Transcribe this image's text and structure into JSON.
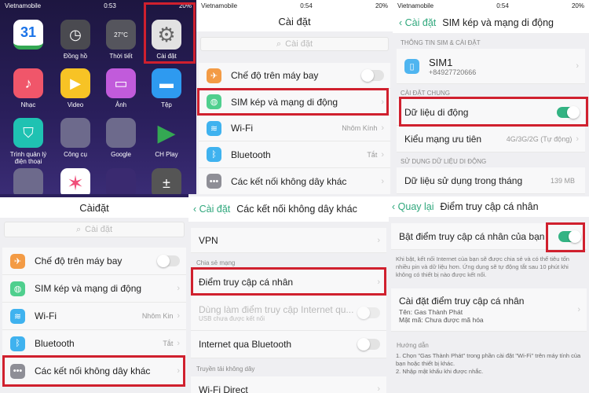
{
  "status": {
    "carrier": "Vietnamobile",
    "time1": "0:53",
    "time2": "0:54",
    "battery": "20%"
  },
  "home": {
    "apps": [
      {
        "label": "",
        "icon": "calendar-icon",
        "glyph": "31",
        "color": "#ffffff"
      },
      {
        "label": "Đồng hồ",
        "icon": "clock-icon",
        "glyph": "◷",
        "color": "#4a4a50"
      },
      {
        "label": "Thời tiết",
        "icon": "weather-icon",
        "glyph": "27°C",
        "color": "#55555d"
      },
      {
        "label": "Cài đặt",
        "icon": "gear-icon",
        "glyph": "⚙",
        "color": "#e2e2e2"
      },
      {
        "label": "Nhạc",
        "icon": "music-icon",
        "glyph": "♪",
        "color": "#f0566a"
      },
      {
        "label": "Video",
        "icon": "video-icon",
        "glyph": "▶",
        "color": "#f7c325"
      },
      {
        "label": "Ảnh",
        "icon": "photo-icon",
        "glyph": "▭",
        "color": "#c15bdb"
      },
      {
        "label": "Tệp",
        "icon": "folder-icon",
        "glyph": "▬",
        "color": "#2e9af0"
      },
      {
        "label": "Trình quản lý điện thoại",
        "icon": "shield-icon",
        "glyph": "⛉",
        "color": "#1fc2b2"
      },
      {
        "label": "Công cụ",
        "icon": "folder-tools-icon",
        "glyph": "",
        "color": "#6d6a8c"
      },
      {
        "label": "Google",
        "icon": "folder-google-icon",
        "glyph": "",
        "color": "#6d6a8c"
      },
      {
        "label": "CH Play",
        "icon": "play-store-icon",
        "glyph": "▶",
        "color": "transparent"
      },
      {
        "label": "",
        "icon": "folder-icon",
        "glyph": "",
        "color": "#6d6a8c"
      },
      {
        "label": "",
        "icon": "star-app-icon",
        "glyph": "✶",
        "color": "#ffffff"
      },
      {
        "label": "",
        "icon": "game-icon",
        "glyph": "",
        "color": "#3a2a70"
      },
      {
        "label": "",
        "icon": "calculator-icon",
        "glyph": "±",
        "color": "#555"
      }
    ]
  },
  "settings": {
    "title": "Cài đặt",
    "title_alt": "Càiđặt",
    "search_placeholder": "Cài đặt",
    "items": [
      {
        "label": "Chế độ trên máy bay",
        "value": "",
        "icon": "airplane-icon",
        "color": "#f39b45"
      },
      {
        "label": "SIM kép và mạng di động",
        "value": "",
        "icon": "globe-icon",
        "color": "#4fcf8e"
      },
      {
        "label": "Wi-Fi",
        "value": "Nhôm Kính",
        "icon": "wifi-icon",
        "color": "#3fb2ef"
      },
      {
        "label": "Bluetooth",
        "value": "Tắt",
        "icon": "bluetooth-icon",
        "color": "#3fb2ef"
      },
      {
        "label": "Các kết nối không dây khác",
        "value": "",
        "icon": "more-icon",
        "color": "#8e8e96"
      }
    ],
    "items_alt": {
      "wifi_value": "Nhôm Kin",
      "bt_value": "Tắt"
    }
  },
  "sim": {
    "back": "Cài đặt",
    "title": "SIM kép và mạng di động",
    "sec1": "THÔNG TIN SIM & CÀI ĐẶT",
    "sim_name": "SIM1",
    "sim_number": "+84927720666",
    "sec2": "CÀI ĐẶT CHUNG",
    "mobile_data": "Dữ liệu di động",
    "mobile_data_on": true,
    "net_type": "Kiểu mạng ưu tiên",
    "net_type_value": "4G/3G/2G (Tự động)",
    "sec3": "SỬ DỤNG DỮ LIỆU DI ĐỘNG",
    "usage": "Dữ liệu sử dụng trong tháng",
    "usage_value": "139 MB"
  },
  "wireless": {
    "back": "Cài đặt",
    "title": "Các kết nối không dây khác",
    "vpn": "VPN",
    "sec1": "Chia sẻ mạng",
    "hotspot": "Điểm truy cập cá nhân",
    "usb": "Dùng làm điểm truy cập Internet qu...",
    "usb_sub": "USB chưa được kết nối",
    "bt_tether": "Internet qua Bluetooth",
    "sec2": "Truyền tải không dây",
    "wifi_direct": "Wi-Fi Direct"
  },
  "hotspot": {
    "back": "Quay lại",
    "title": "Điểm truy cập cá nhân",
    "enable": "Bật điểm truy cập cá nhân của bạn",
    "enabled": true,
    "desc": "Khi bật, kết nối Internet của bạn sẽ được chia sẻ và có thể tiêu tốn nhiều pin và dữ liệu hơn. Ứng dụng sẽ tự động tắt sau 10 phút khi không có thiết bị nào được kết nối.",
    "setup": "Cài đặt điểm truy cập cá nhân",
    "name": "Tên: Gas Thành Phát",
    "password": "Mật mã: Chưa được mã hóa",
    "guide": "Hướng dẫn",
    "step1": "1. Chọn \"Gas Thành Phát\" trong phần cài đặt \"Wi-Fi\" trên máy tính của bạn hoặc thiết bị khác.",
    "step2": "2. Nhập mật khẩu khi được nhắc."
  }
}
